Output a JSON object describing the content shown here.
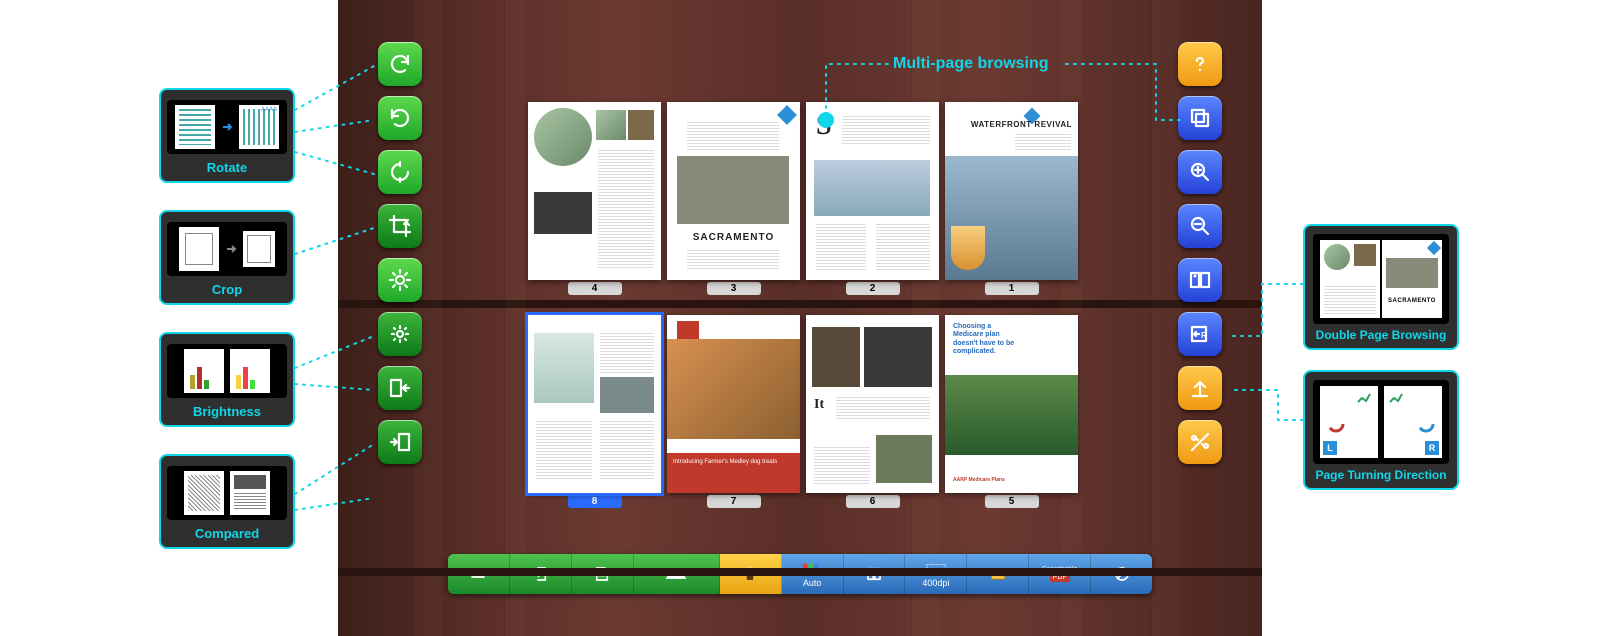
{
  "annotations": {
    "multipage": "Multi-page browsing",
    "rotate": "Rotate",
    "crop": "Crop",
    "brightness": "Brightness",
    "compared": "Compared",
    "double_page": "Double Page Browsing",
    "page_turning": "Page Turning Direction",
    "page_turning_left_badge": "L",
    "page_turning_right_badge": "R"
  },
  "left_toolbar": [
    {
      "id": "rotate-cw",
      "name": "rotate-right-icon"
    },
    {
      "id": "rotate-ccw",
      "name": "rotate-left-icon"
    },
    {
      "id": "rotate-180",
      "name": "rotate-180-icon"
    },
    {
      "id": "crop",
      "name": "crop-icon"
    },
    {
      "id": "brightness-up",
      "name": "brightness-up-icon"
    },
    {
      "id": "brightness-down",
      "name": "brightness-down-icon"
    },
    {
      "id": "compare-left",
      "name": "compare-left-icon"
    },
    {
      "id": "compare-right",
      "name": "compare-right-icon"
    }
  ],
  "right_toolbar": [
    {
      "id": "help",
      "name": "help-icon",
      "color": "orange"
    },
    {
      "id": "multi-page",
      "name": "multi-page-icon",
      "color": "blue"
    },
    {
      "id": "zoom-in",
      "name": "zoom-in-icon",
      "color": "blue"
    },
    {
      "id": "zoom-out",
      "name": "zoom-out-icon",
      "color": "blue"
    },
    {
      "id": "double-page",
      "name": "double-page-icon",
      "color": "blue"
    },
    {
      "id": "page-direction",
      "name": "page-direction-icon",
      "color": "blue"
    },
    {
      "id": "export",
      "name": "export-icon",
      "color": "orange"
    },
    {
      "id": "settings",
      "name": "settings-icon",
      "color": "orange"
    }
  ],
  "bottom_toolbar": [
    {
      "id": "flatbed",
      "name": "flatbed-icon",
      "color": "green",
      "label": ""
    },
    {
      "id": "exit",
      "name": "exit-icon",
      "color": "green",
      "label": ""
    },
    {
      "id": "save",
      "name": "save-icon",
      "color": "green",
      "label": ""
    },
    {
      "id": "scan",
      "name": "scan-icon",
      "color": "green",
      "label": ""
    },
    {
      "id": "delete",
      "name": "delete-icon",
      "color": "yellow",
      "label": ""
    },
    {
      "id": "auto",
      "name": "auto-icon",
      "color": "blue",
      "label": "Auto"
    },
    {
      "id": "book-mode",
      "name": "book-mode-icon",
      "color": "blue",
      "label": ""
    },
    {
      "id": "dpi",
      "name": "dpi-icon",
      "color": "blue",
      "label": "400dpi"
    },
    {
      "id": "folder",
      "name": "folder-icon",
      "color": "blue",
      "label": ""
    },
    {
      "id": "searchable-pdf",
      "name": "pdf-icon",
      "color": "blue",
      "label": "Searchable",
      "sub": "PDF"
    },
    {
      "id": "watermark",
      "name": "watermark-icon",
      "color": "blue",
      "label": ""
    }
  ],
  "pages": {
    "row1": [
      {
        "num": "4",
        "title": ""
      },
      {
        "num": "3",
        "title": "SACRAMENTO"
      },
      {
        "num": "2",
        "title": "S"
      },
      {
        "num": "1",
        "title": "WATERFRONT REVIVAL"
      }
    ],
    "row2": [
      {
        "num": "8",
        "selected": true,
        "title": ""
      },
      {
        "num": "7",
        "title": "Introducing Farmer's Medley dog treats"
      },
      {
        "num": "6",
        "title": "It"
      },
      {
        "num": "5",
        "title": "Choosing a Medicare plan doesn't have to be complicated."
      }
    ]
  }
}
